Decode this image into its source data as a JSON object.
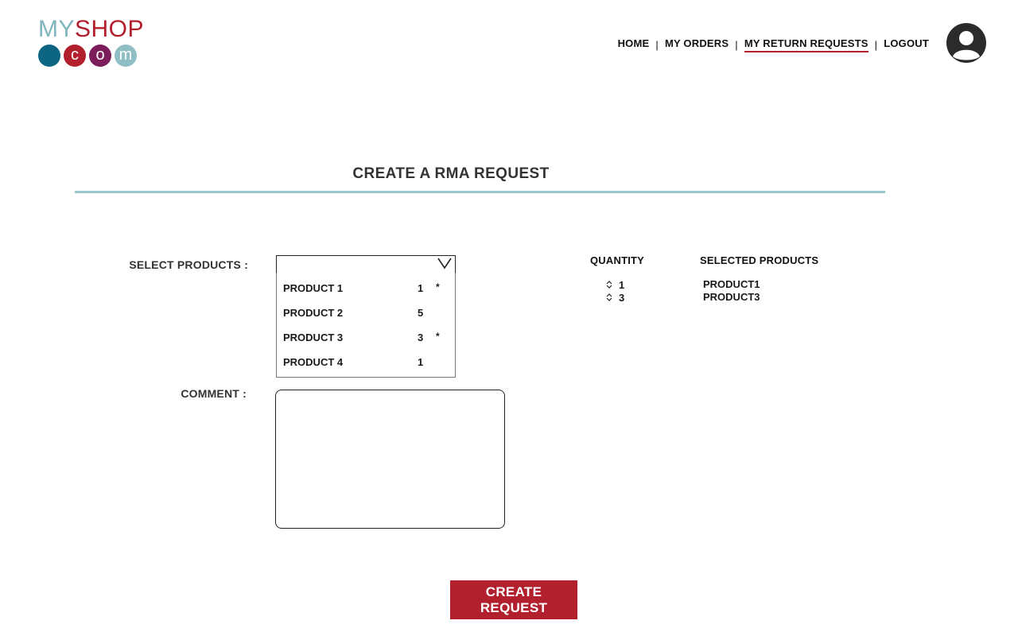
{
  "logo": {
    "text_my": "MY",
    "text_shop": "SHOP",
    "circles": [
      {
        "letter": "",
        "color": "#0d6584"
      },
      {
        "letter": "c",
        "color": "#b21f2d"
      },
      {
        "letter": "o",
        "color": "#7b1e5a"
      },
      {
        "letter": "m",
        "color": "#8fbfc4"
      }
    ]
  },
  "nav": {
    "items": [
      "HOME",
      "MY ORDERS",
      "MY RETURN REQUESTS",
      "LOGOUT"
    ],
    "separator": "|",
    "active_index": 2
  },
  "avatar_icon": "user-avatar-icon",
  "page_title": "CREATE A RMA REQUEST",
  "form": {
    "select_label": "SELECT PRODUCTS :",
    "select_value": "",
    "comment_label": "COMMENT :",
    "comment_value": ""
  },
  "dropdown": {
    "options": [
      {
        "name": "PRODUCT 1",
        "qty": "1",
        "mark": "*"
      },
      {
        "name": "PRODUCT 2",
        "qty": "5",
        "mark": ""
      },
      {
        "name": "PRODUCT 3",
        "qty": "3",
        "mark": "*"
      },
      {
        "name": "PRODUCT 4",
        "qty": "1",
        "mark": ""
      }
    ]
  },
  "selected": {
    "quantity_header": "QUANTITY",
    "products_header": "SELECTED PRODUCTS",
    "quantities": [
      "1",
      "3"
    ],
    "products": [
      "PRODUCT1",
      "PRODUCT3"
    ]
  },
  "create_button": "CREATE REQUEST",
  "colors": {
    "brand_red": "#b21f2d",
    "accent_teal": "#9ac7c9"
  }
}
